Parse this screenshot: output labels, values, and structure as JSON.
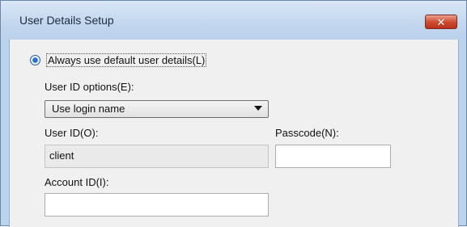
{
  "window": {
    "title": "User Details Setup",
    "close_glyph": "✕"
  },
  "radio_option": {
    "label": "Always use default user details(L)",
    "checked": true
  },
  "user_id_options": {
    "label": "User ID options(E):",
    "selected": "Use login name"
  },
  "user_id": {
    "label": "User ID(O):",
    "value": "client"
  },
  "passcode": {
    "label": "Passcode(N):",
    "value": ""
  },
  "account_id": {
    "label": "Account ID(I):",
    "value": ""
  },
  "colors": {
    "title_bar": "#c2d6ee",
    "close_button": "#cf4d33",
    "dialog_background": "#f0f0f0",
    "readonly_field": "#eaeaea"
  }
}
